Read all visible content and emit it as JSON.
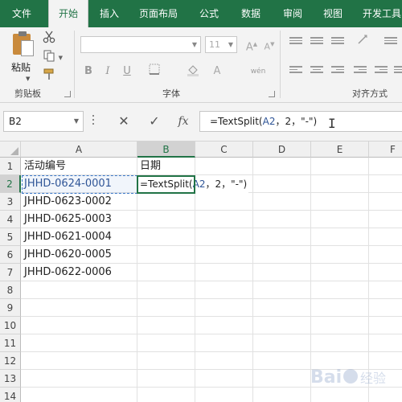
{
  "tabs": [
    {
      "label": "文件",
      "active": false
    },
    {
      "label": "开始",
      "active": true
    },
    {
      "label": "插入",
      "active": false
    },
    {
      "label": "页面布局",
      "active": false
    },
    {
      "label": "公式",
      "active": false
    },
    {
      "label": "数据",
      "active": false
    },
    {
      "label": "审阅",
      "active": false
    },
    {
      "label": "视图",
      "active": false
    },
    {
      "label": "开发工具",
      "active": false
    }
  ],
  "ribbon": {
    "clipboard": {
      "paste_label": "粘贴",
      "group_label": "剪贴板"
    },
    "font": {
      "font_name_value": "",
      "font_size_value": "11",
      "bold_label": "B",
      "italic_label": "I",
      "underline_label": "U",
      "group_label": "字体"
    },
    "alignment": {
      "group_label": "对齐方式"
    }
  },
  "formula_bar": {
    "name_box": "B2",
    "formula_parts": {
      "prefix": "=TextSplit(",
      "ref": "A2",
      "suffix": "，2，\"-\")"
    }
  },
  "grid": {
    "columns": [
      "A",
      "B",
      "C",
      "D",
      "E",
      "F"
    ],
    "active_column": "B",
    "rows": [
      "1",
      "2",
      "3",
      "4",
      "5",
      "6",
      "7",
      "8",
      "9",
      "10",
      "11",
      "12",
      "13",
      "14"
    ],
    "active_row": "2",
    "cells": {
      "A1": "活动编号",
      "B1": "日期",
      "A2": "JHHD-0624-0001",
      "A3": "JHHD-0623-0002",
      "A4": "JHHD-0625-0003",
      "A5": "JHHD-0621-0004",
      "A6": "JHHD-0620-0005",
      "A7": "JHHD-0622-0006"
    },
    "b2_editing": {
      "prefix": "=TextSplit(",
      "ref": "A2",
      "suffix": "，2，\"-\")"
    }
  },
  "colors": {
    "accent": "#217346",
    "reference_blue": "#2f5597",
    "selection_dash": "#3c78c8"
  },
  "icons": [
    "paste-icon",
    "cut-icon",
    "copy-icon",
    "format-painter-icon",
    "cancel-icon",
    "enter-icon",
    "insert-function-icon",
    "text-cursor-icon",
    "baidu-jingyan-watermark"
  ]
}
